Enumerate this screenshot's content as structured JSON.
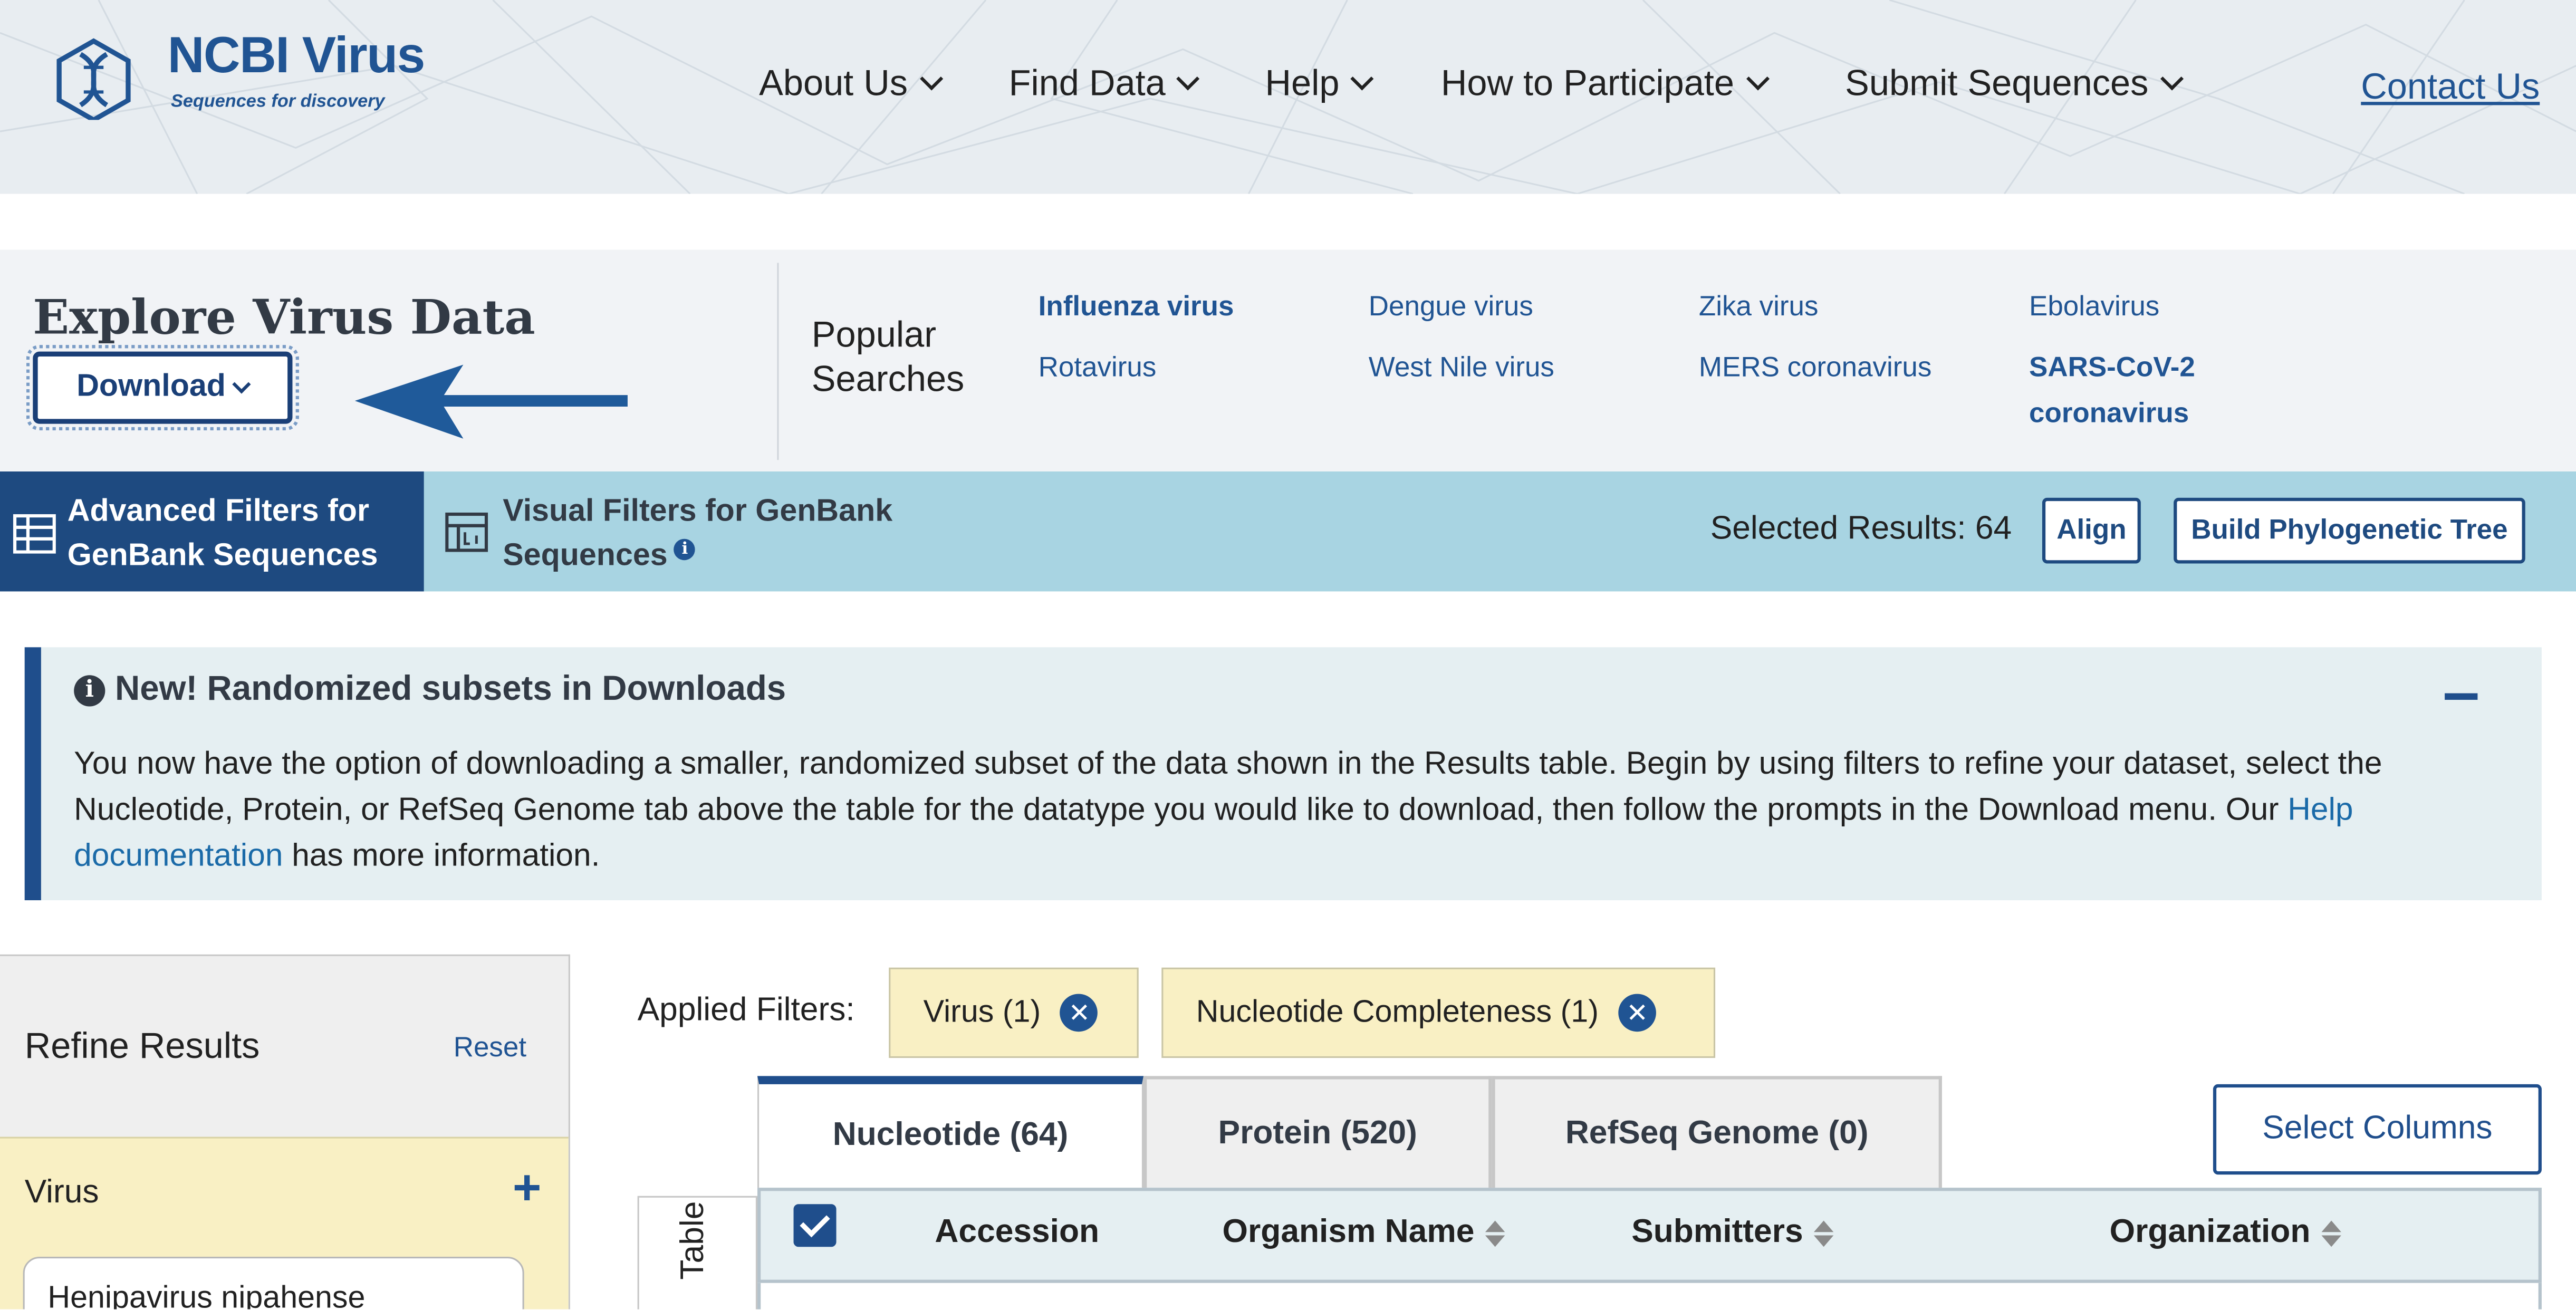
{
  "header": {
    "logo_title": "NCBI Virus",
    "logo_tagline": "Sequences for discovery",
    "nav": [
      "About Us",
      "Find Data",
      "Help",
      "How to Participate",
      "Submit Sequences"
    ],
    "contact": "Contact Us"
  },
  "explore": {
    "title": "Explore Virus Data",
    "download_label": "Download",
    "popular_label": "Popular Searches",
    "popular_searches": [
      "Influenza virus",
      "Dengue virus",
      "Zika virus",
      "Ebolavirus",
      "Rotavirus",
      "West Nile virus",
      "MERS coronavirus",
      "SARS-CoV-2 coronavirus"
    ]
  },
  "filter_tabs": {
    "advanced": "Advanced Filters for GenBank Sequences",
    "visual": "Visual Filters for GenBank Sequences",
    "selected_results": "Selected Results: 64",
    "align": "Align",
    "phylo": "Build Phylogenetic Tree"
  },
  "notice": {
    "title": "New! Randomized subsets in Downloads",
    "body_before": "You now have the option of downloading a smaller, randomized subset of the data shown in the Results table. Begin by using filters to refine your dataset, select the Nucleotide, Protein, or RefSeq Genome tab above the table for the datatype you would like to download, then follow the prompts in the Download menu. Our ",
    "link": "Help documentation",
    "body_after": " has more information."
  },
  "refine": {
    "title": "Refine Results",
    "reset": "Reset",
    "virus_label": "Virus",
    "virus_value": "Henipavirus nipahense"
  },
  "results": {
    "applied_label": "Applied Filters:",
    "chips": [
      "Virus (1)",
      "Nucleotide Completeness (1)"
    ],
    "tabs": [
      "Nucleotide (64)",
      "Protein (520)",
      "RefSeq Genome (0)"
    ],
    "select_columns": "Select Columns",
    "side_tab": "Table",
    "columns": [
      "Accession",
      "Organism Name",
      "Submitters",
      "Organization"
    ]
  },
  "colors": {
    "brand_blue": "#205493",
    "dark_blue": "#1e4a80",
    "tab_bar": "#a8d4e2",
    "chip_yellow": "#f9f0c4"
  },
  "icons": [
    "ncbi-virus-logo",
    "chevron-down-icon",
    "arrow-left-icon",
    "table-icon",
    "chart-icon",
    "info-icon",
    "collapse-icon",
    "close-icon",
    "plus-icon",
    "sort-icon",
    "checkbox-icon"
  ]
}
